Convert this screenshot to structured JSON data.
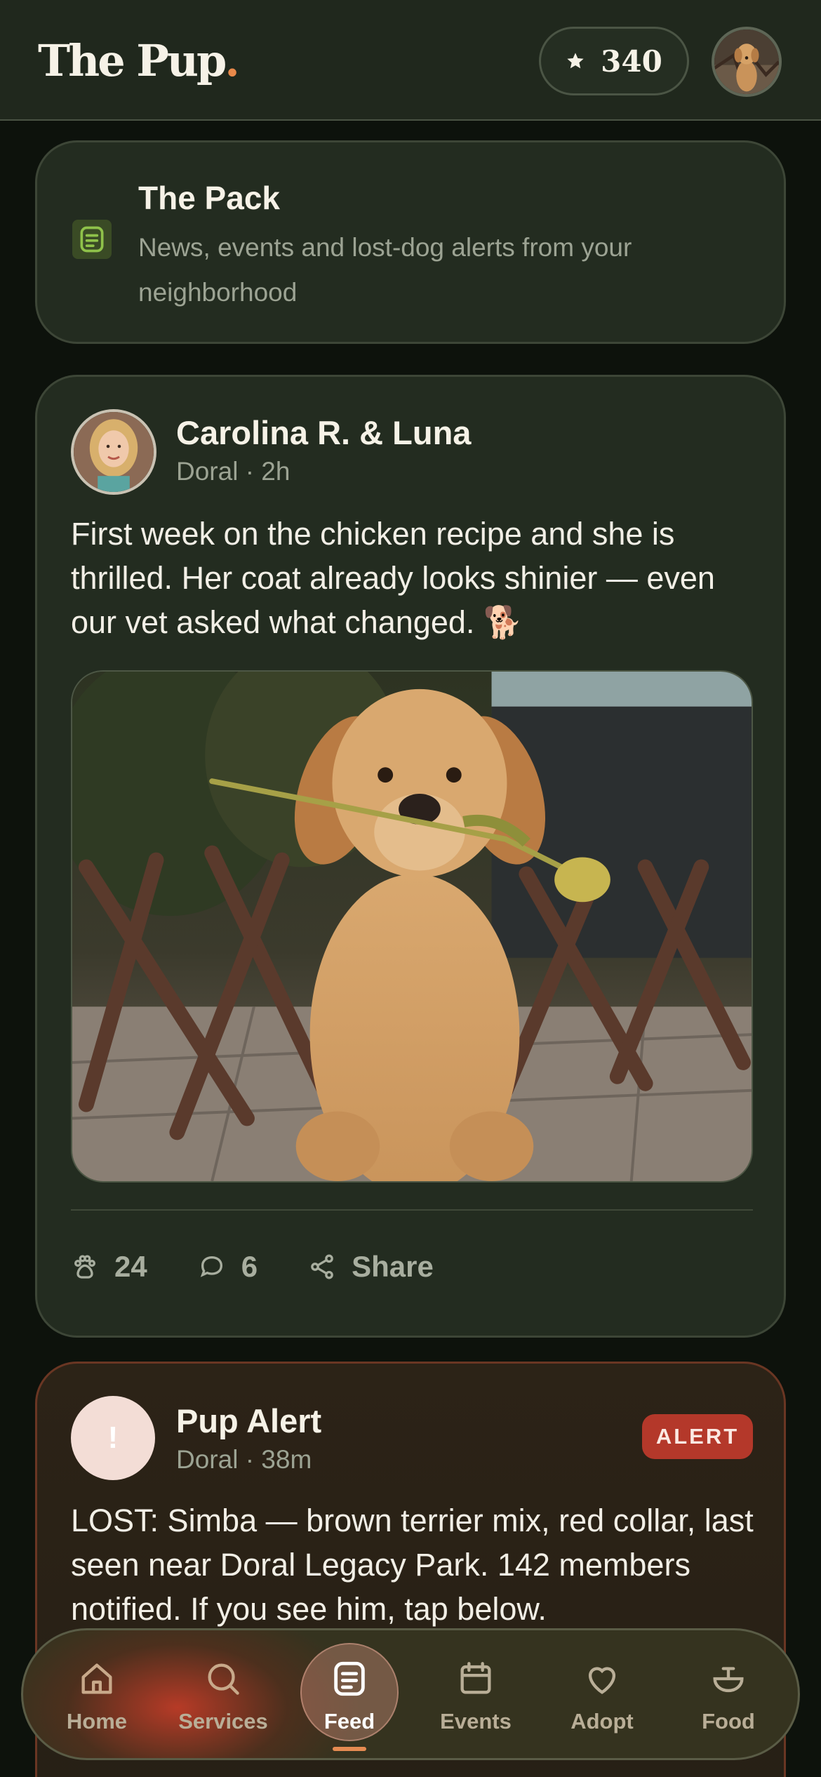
{
  "app": {
    "name": "The Pup",
    "accent": "#e8894a"
  },
  "header": {
    "logo_text": "The Pup",
    "logo_dot": ".",
    "points": "340",
    "points_icon": "star-icon"
  },
  "pack": {
    "title": "The Pack",
    "subtitle": "News, events and lost-dog alerts from your neighborhood",
    "icon": "feed-icon"
  },
  "post": {
    "author": "Carolina R. & Luna",
    "meta": "Doral · 2h",
    "text": "First week on the chicken recipe and she is thrilled. Her coat already looks shinier — even our vet asked what changed. 🐕",
    "likes": "24",
    "comments": "6",
    "share_label": "Share"
  },
  "alert": {
    "title": "Pup Alert",
    "meta": "Doral · 38m",
    "badge": "ALERT",
    "icon_glyph": "!",
    "text": "LOST: Simba — brown terrier mix, red collar, last seen near Doral Legacy Park. 142 members notified. If you see him, tap below.",
    "badge_color": "#b4382a"
  },
  "tabs": [
    {
      "label": "Home",
      "icon": "home-icon"
    },
    {
      "label": "Services",
      "icon": "search-icon"
    },
    {
      "label": "Feed",
      "icon": "feed-icon",
      "active": true
    },
    {
      "label": "Events",
      "icon": "calendar-icon"
    },
    {
      "label": "Adopt",
      "icon": "heart-icon"
    },
    {
      "label": "Food",
      "icon": "bowl-icon"
    }
  ]
}
